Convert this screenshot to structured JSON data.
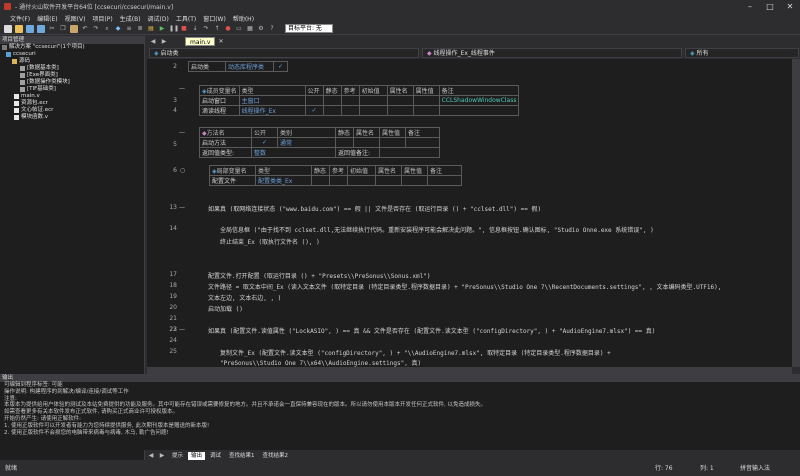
{
  "title": "- 通付火山软件开发平台64位 [ccsecuri/ccsecuri/main.v]",
  "menu": [
    "文件(F)",
    "编辑(E)",
    "视图(V)",
    "项目(P)",
    "生成(B)",
    "调试(D)",
    "工具(T)",
    "窗口(W)",
    "帮助(H)"
  ],
  "toolbar": {
    "target_label": "目标平台: 无"
  },
  "left": {
    "header": "项目管理",
    "solution": "解决方案 \"ccsecuri\"(1个项目)",
    "project": "ccsecuri",
    "tree": [
      "源码",
      "[数据基本类]",
      "[Exe界面类]",
      "[数据操作类模块]",
      "[TIF基础类]",
      "main.v",
      "资源包.ecr",
      "文心帖证.ecr",
      "模块函数.v"
    ]
  },
  "tabs": {
    "active": "main.v"
  },
  "nav": {
    "left": "启动类",
    "mid": "线程操作_Ex_线程事件",
    "right": "所有"
  },
  "lines": {
    "l2": "2",
    "l3": "3",
    "l4": "4",
    "l5": "5",
    "l6": "6",
    "l13": "13",
    "l14": "14",
    "l17": "17",
    "l18": "18",
    "l19": "19",
    "l20": "20",
    "l21": "21",
    "l22": "22",
    "l23": "23",
    "l24": "24",
    "l25": "25"
  },
  "table1": {
    "c1": "启动类",
    "c2": "动态库程序类"
  },
  "table2": {
    "headers": [
      "成员变量名",
      "类型",
      "公开",
      "静态",
      "参考",
      "初始值",
      "属性名",
      "属性值",
      "备注"
    ],
    "rows": [
      [
        "启动窗口",
        "主窗口",
        "",
        "",
        "",
        "",
        "",
        "",
        "CCLShadowWindowClass"
      ],
      [
        "滴读线程",
        "线程操作_Ex",
        "✓",
        "",
        "",
        "",
        "",
        "",
        ""
      ]
    ]
  },
  "table3": {
    "headers": [
      "方法名",
      "公开",
      "类别",
      "静态",
      "属性名",
      "属性值",
      "备注"
    ],
    "row": [
      "启动方法",
      "✓",
      "通常",
      "",
      "",
      "",
      ""
    ],
    "ret_label": "返回值类型:",
    "ret_type": "整数",
    "ret_note_label": "返回值备注:"
  },
  "table4": {
    "headers": [
      "局部变量名",
      "类型",
      "静态",
      "参考",
      "初始值",
      "属性名",
      "属性值",
      "备注"
    ],
    "row": [
      "配置文件",
      "配置类类_Ex",
      "",
      "",
      "",
      "",
      "",
      ""
    ]
  },
  "code": {
    "c13": "如果真 (取网络连接状态 (\"www.baidu.com\") == 假 || 文件是否存在 (取运行目录 () + \"cclset.dll\") == 假)",
    "c14a": "全局信息框 (\"由于找不到 cclset.dll,无法继续执行代码。重新安装程序可能会解决此问题。\", 信息框按钮.确认图标, \"Studio Onne.exe 系统错误\", )",
    "c14b": "终止结束_Ex (取执行文件名 (), )",
    "c17": "配置文件.打开配置 (取运行目录 () + \"Presets\\\\PreSonus\\\\Sonus.xml\")",
    "c18": "文件路径 = 取文本中间_Ex (读入文本文件 (取特定目录 (特定目录类型.程序数据目录) + \"PreSonus\\\\Studio One 7\\\\RecentDocuments.settings\", , 文本编码类型.UTF16),",
    "c19": "文本左边, 文本右边, , )",
    "c20": "启动加载 ()",
    "c22": "如果真 (配置文件.读值属性 (\"LockASIO\", ) == 真 && 文件是否存在 (配置文件.读文本型 (\"configDirectory\", ) + \"AudioEngine7.mlsx\") == 真)",
    "c24": "复制文件_Ex (配置文件.读文本型 (\"configDirectory\", ) + \"\\\\AudioEngine7.mlsx\", 取特定目录 (特定目录类型.程序数据目录) +",
    "c25": "\"PreSonus\\\\Studio One 7\\\\x64\\\\AudioEngine.settings\", 真)"
  },
  "output": {
    "header": "输出",
    "lines": [
      "    可编辑到程序标签: 可能",
      "    操作说明: 构建程序的到解决/编译/连接/调试等工作",
      "",
      "注意:",
      "    本版本为提供给用户体验的测试及本站免费提供的功能及服务。其中可能存在错误或需要修复的地方。并且不承诺会一直保持兼容现在的版本。所以请勿使用本版本开发任何正式软件, 以免造成损失。",
      "    如需查看更多有关本软件发布正式软件, 请购买正式商业许可授权版本。",
      "",
      "开始仍然产生: 请使用正解软件:",
      "    1. 使用正版软件可以开发者有能力为您持续提供服务, 此次期刊版本是赠送的新本版!",
      "    2. 使用正版软件不会损您的电脑带来病毒与病毒, 木马, 勒广告问题!",
      "    3. 使用正版软件不会给您带来失律风险, 而且能保证产品功能正确无误地运行。"
    ]
  },
  "bottom_tabs": [
    "提示",
    "输出",
    "调试",
    "查找结果1",
    "查找结果2"
  ],
  "status": {
    "left": "就绪",
    "line": "行: 76",
    "col": "列: 1",
    "ime": "拼音输入法"
  }
}
